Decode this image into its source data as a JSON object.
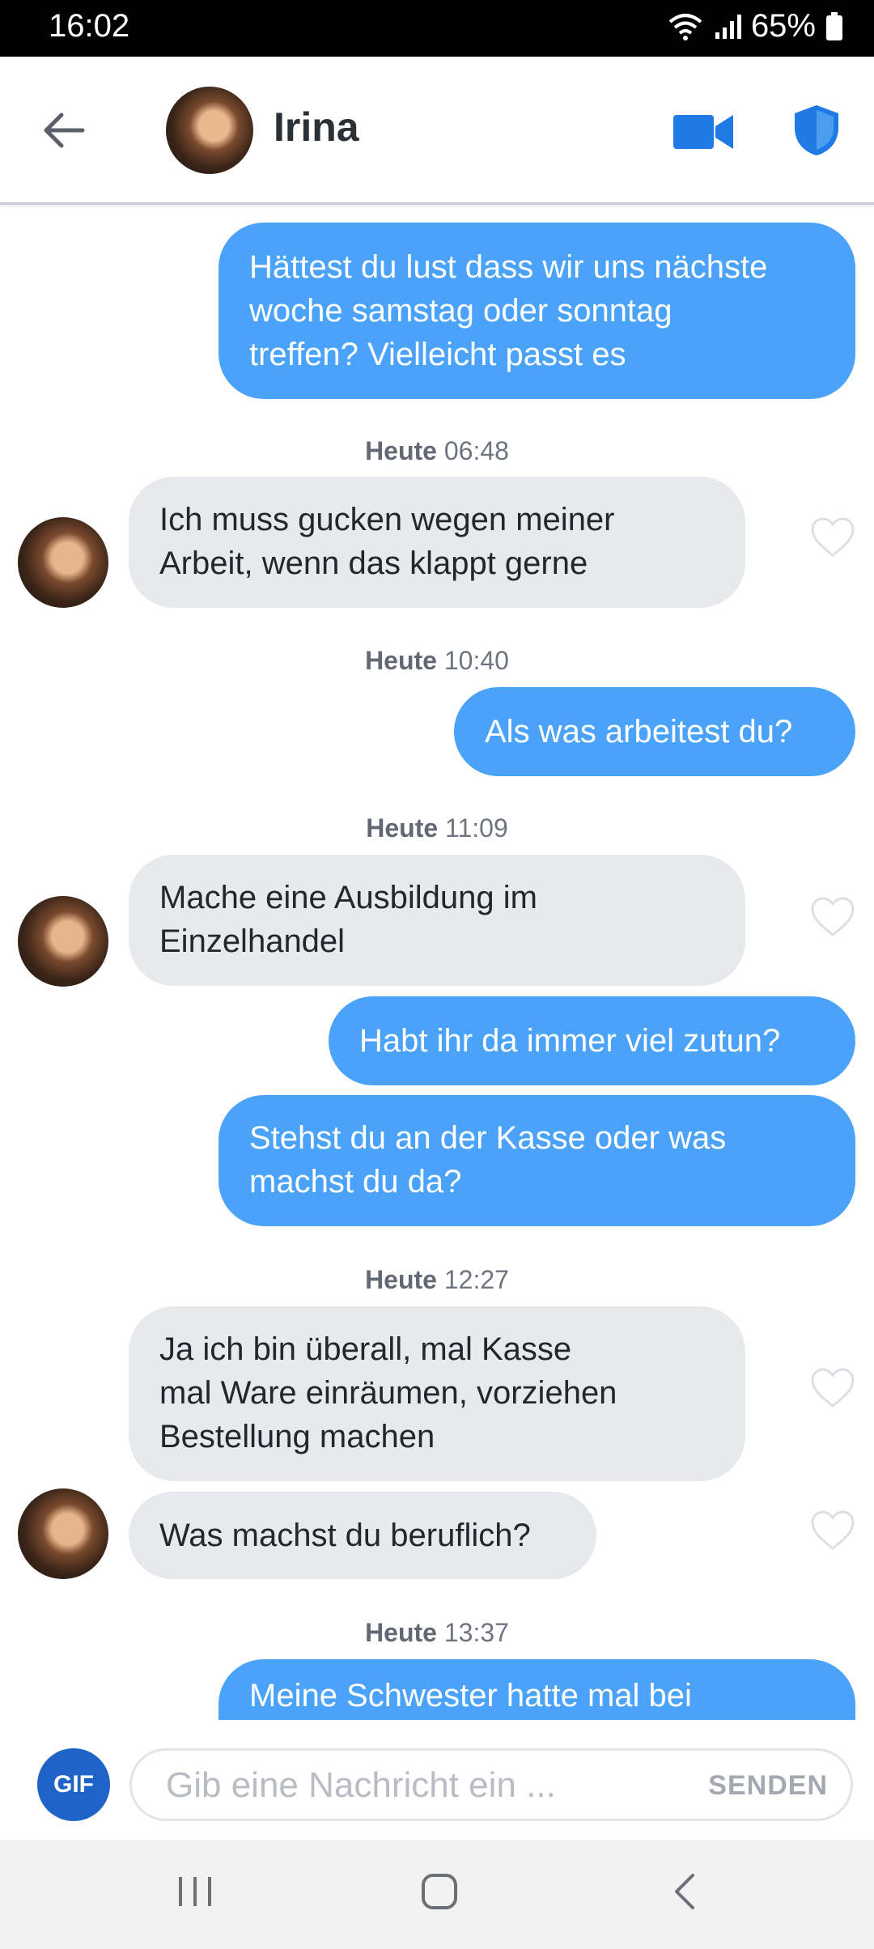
{
  "status_bar": {
    "time": "16:02",
    "battery": "65%"
  },
  "header": {
    "contact_name": "Irina"
  },
  "messages": [
    {
      "sent_1": [
        "Hättest du lust dass wir uns nächste",
        "woche samstag oder sonntag",
        "treffen? Vielleicht passt es"
      ]
    },
    {
      "stamp_1_day": "Heute",
      "stamp_1_time": "06:48"
    },
    {
      "recv_1": [
        "Ich muss gucken wegen meiner",
        "Arbeit, wenn das klappt gerne"
      ]
    },
    {
      "stamp_2_day": "Heute",
      "stamp_2_time": "10:40"
    },
    {
      "sent_2": [
        "Als was arbeitest du?"
      ]
    },
    {
      "stamp_3_day": "Heute",
      "stamp_3_time": "11:09"
    },
    {
      "recv_2": [
        "Mache eine Ausbildung im",
        "Einzelhandel"
      ]
    },
    {
      "sent_3": [
        "Habt ihr da immer viel zutun?"
      ]
    },
    {
      "sent_4": [
        "Stehst du an der Kasse oder was",
        "machst du da?"
      ]
    },
    {
      "stamp_4_day": "Heute",
      "stamp_4_time": "12:27"
    },
    {
      "recv_3": [
        "Ja ich bin überall, mal Kasse",
        "mal Ware einräumen, vorziehen",
        "Bestellung machen"
      ]
    },
    {
      "recv_4": [
        "Was machst du beruflich?"
      ]
    },
    {
      "stamp_5_day": "Heute",
      "stamp_5_time": "13:37"
    },
    {
      "sent_5": [
        "Meine Schwester hatte mal bei"
      ]
    }
  ],
  "composer": {
    "gif_label": "GIF",
    "placeholder": "Gib eine Nachricht ein ...",
    "send_label": "SENDEN"
  },
  "colors": {
    "sent_bubble": "#4aa3f8",
    "recv_bubble": "#e8e9ed",
    "accent": "#1e64c8"
  }
}
